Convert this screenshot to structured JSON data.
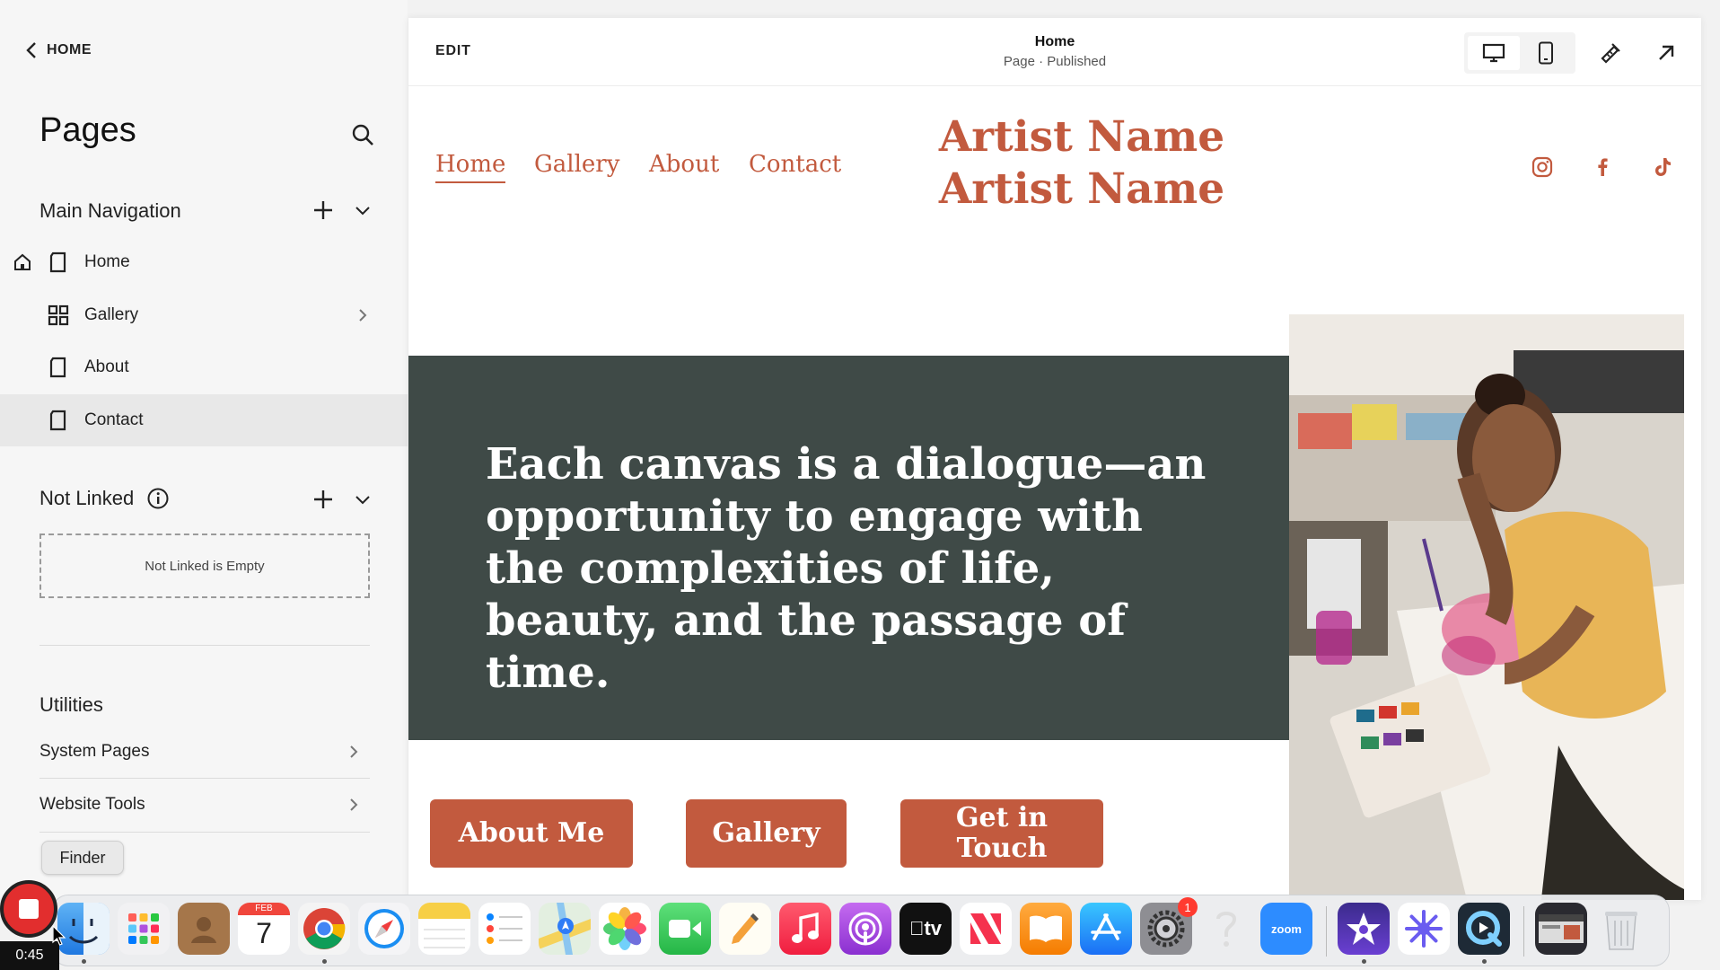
{
  "sidebar": {
    "back_label": "HOME",
    "title": "Pages",
    "main_nav_title": "Main Navigation",
    "main_nav_items": [
      {
        "label": "Home"
      },
      {
        "label": "Gallery"
      },
      {
        "label": "About"
      },
      {
        "label": "Contact"
      }
    ],
    "not_linked_title": "Not Linked",
    "not_linked_empty": "Not Linked is Empty",
    "utilities_title": "Utilities",
    "utilities_items": [
      {
        "label": "System Pages"
      },
      {
        "label": "Website Tools"
      }
    ],
    "tooltip": "Finder"
  },
  "topbar": {
    "edit_label": "EDIT",
    "page_title": "Home",
    "page_status": "Page · Published"
  },
  "site": {
    "nav": [
      "Home",
      "Gallery",
      "About",
      "Contact"
    ],
    "brand_line1": "Artist Name",
    "brand_line2": "Artist Name",
    "social_icons": [
      "instagram-icon",
      "facebook-icon",
      "tiktok-icon"
    ],
    "hero_text": "Each canvas is a dialogue—an opportunity to engage with the complexities of life, beauty, and the passage of time.",
    "buttons": [
      "About Me",
      "Gallery",
      "Get in Touch"
    ],
    "accent_color": "#c25a3e",
    "hero_bg_color": "#3f4a47"
  },
  "dock": {
    "recording_time": "0:45",
    "calendar_month": "FEB",
    "calendar_day": "7",
    "settings_badge": "1",
    "zoom_label": "zoom",
    "tv_label": "tv"
  }
}
